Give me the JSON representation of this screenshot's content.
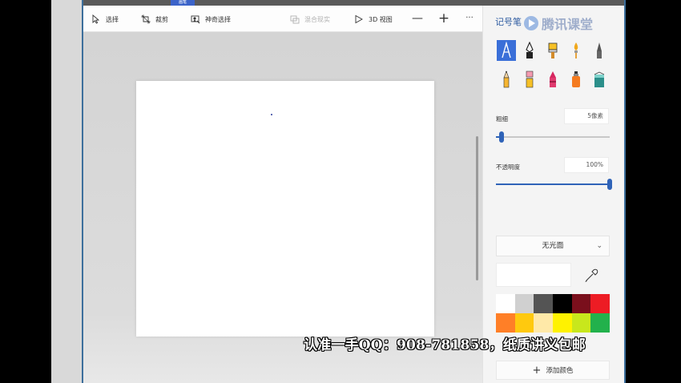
{
  "window": {
    "tab_label": "画笔"
  },
  "toolbar": {
    "select_label": "选择",
    "crop_label": "裁剪",
    "magic_select_label": "神奇选择",
    "mixed_reality_label": "混合现实",
    "view3d_label": "3D 视图",
    "zoom_out_symbol": "—",
    "zoom_in_symbol": "+",
    "more_symbol": "···"
  },
  "panel": {
    "title": "记号笔",
    "watermark": "腾讯课堂",
    "thickness_label": "粗细",
    "thickness_value": "5像素",
    "thickness_fraction": 0.05,
    "opacity_label": "不透明度",
    "opacity_value": "100%",
    "opacity_fraction": 1.0,
    "finish_label": "无光面",
    "add_color_label": "添加颜色",
    "palette": [
      "#ffffff",
      "#d0d0d0",
      "#545454",
      "#000000",
      "#7a0f1c",
      "#ed1c24",
      "#ff7f27",
      "#ffc90e",
      "#ffe9a8",
      "#fff200",
      "#c8e71c",
      "#22b14c"
    ],
    "brushes": [
      "marker-icon",
      "calligraphy-pen-icon",
      "oil-brush-icon",
      "watercolor-brush-icon",
      "pixel-pen-icon",
      "pencil-icon",
      "eraser-icon",
      "crayon-icon",
      "spray-can-icon",
      "fill-bucket-icon"
    ]
  },
  "overlay": {
    "subtitle": "认准一手QQ：908-781858，纸质讲义包邮"
  },
  "colors": {
    "accent": "#3a6fd8",
    "slider": "#2f63b8",
    "panel_title": "#2c5aa0"
  }
}
